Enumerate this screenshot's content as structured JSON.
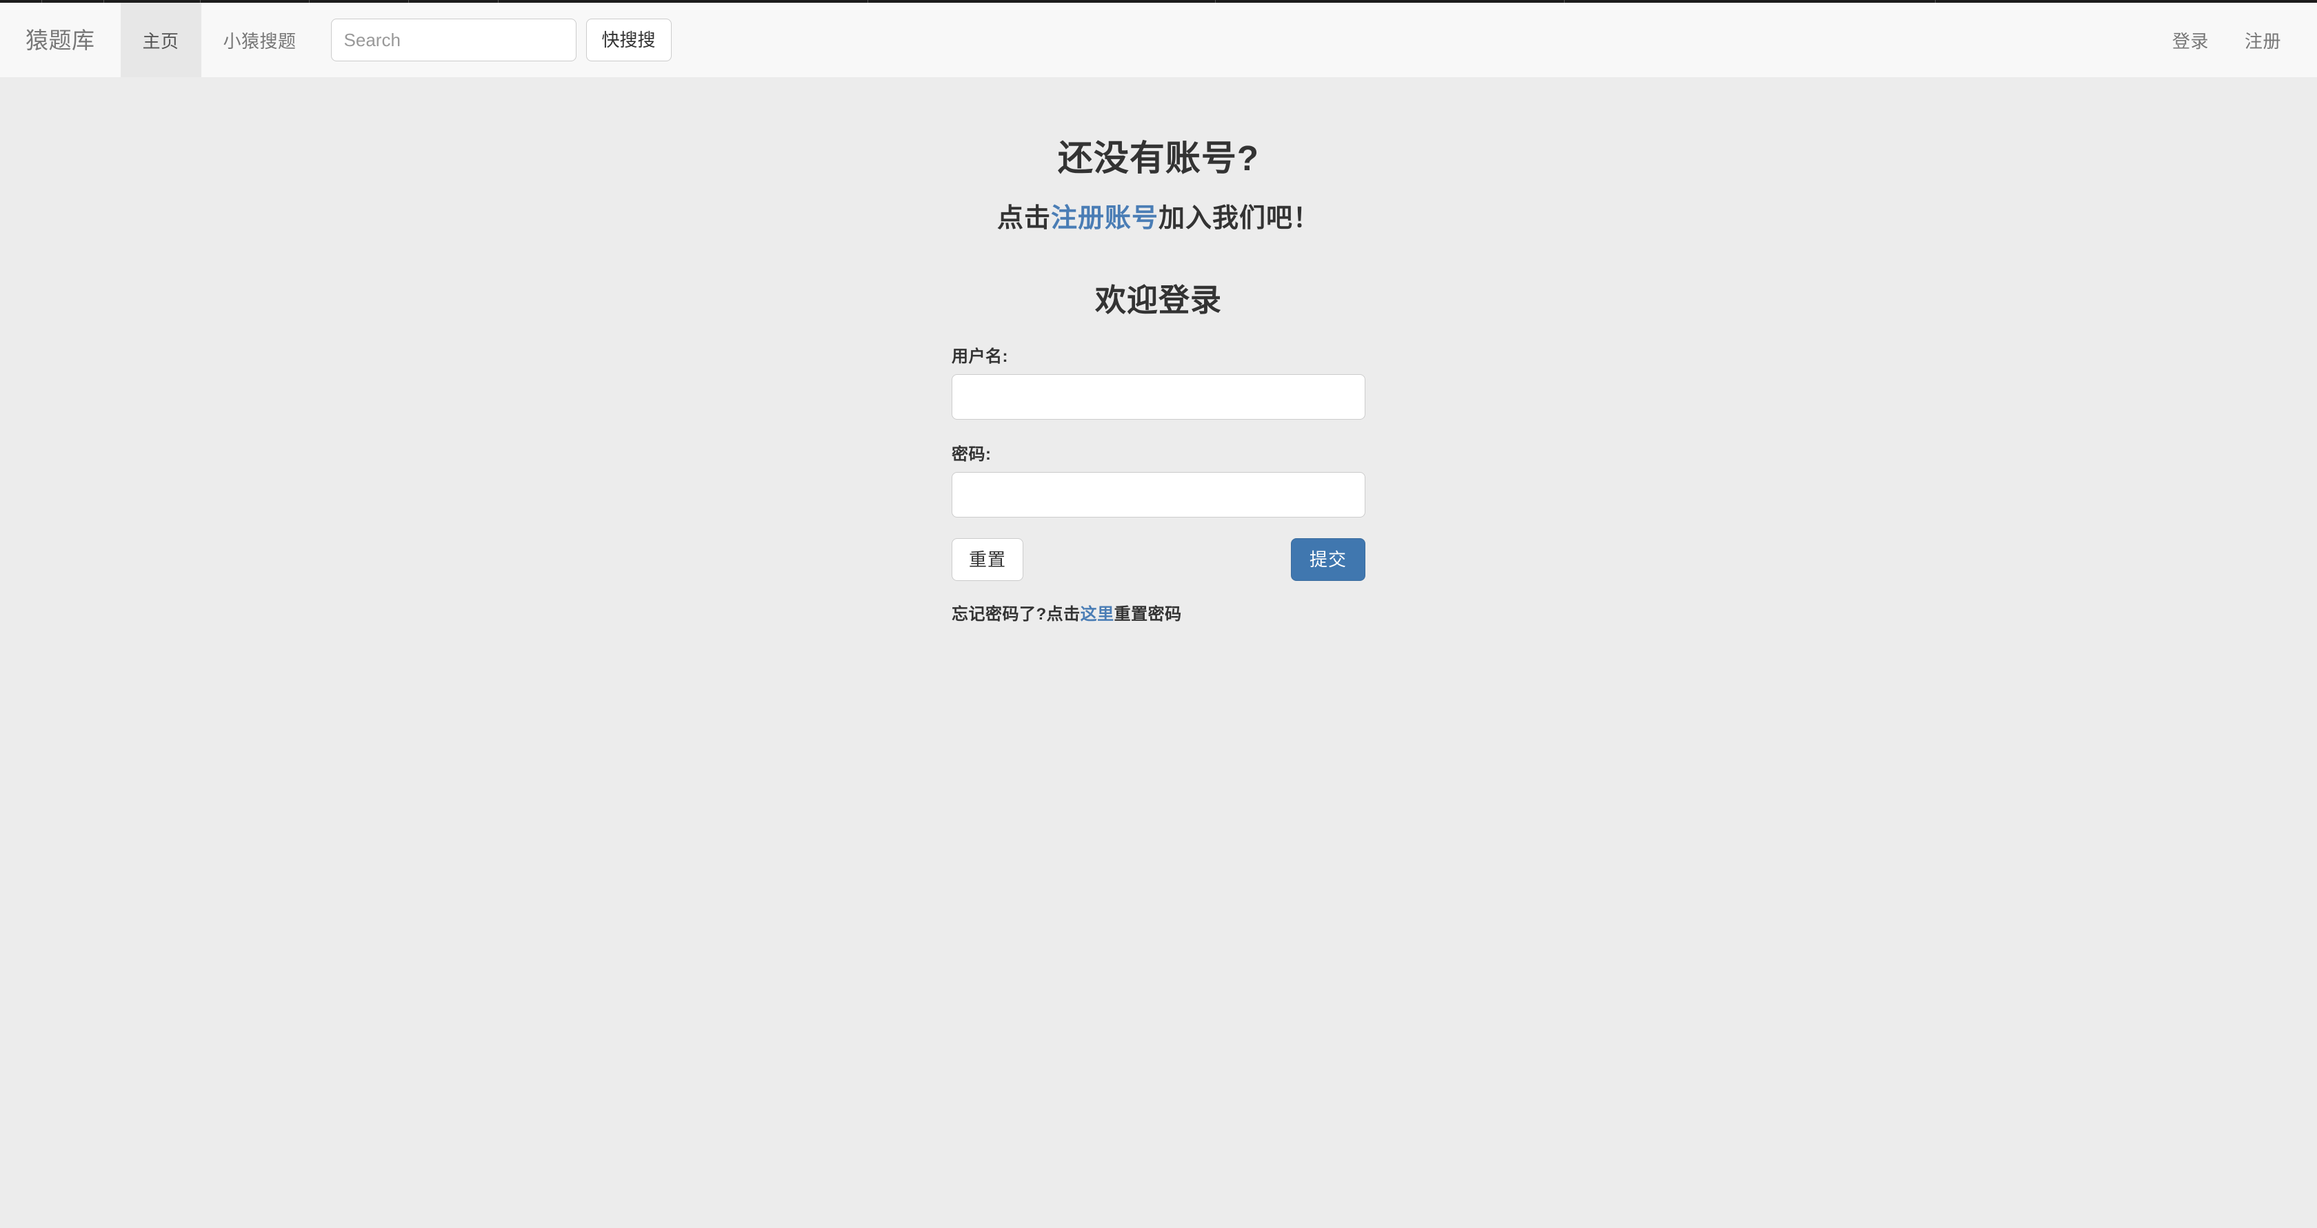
{
  "navbar": {
    "brand": "猿题库",
    "left_items": [
      {
        "label": "主页",
        "active": true
      },
      {
        "label": "小猿搜题",
        "active": false
      }
    ],
    "search": {
      "placeholder": "Search",
      "value": "",
      "button_label": "快搜搜"
    },
    "right_items": [
      {
        "label": "登录"
      },
      {
        "label": "注册"
      }
    ]
  },
  "hero": {
    "title": "还没有账号?",
    "sub_prefix": "点击",
    "sub_link": "注册账号",
    "sub_suffix": "加入我们吧！"
  },
  "form": {
    "title": "欢迎登录",
    "username_label": "用户名:",
    "username_value": "",
    "password_label": "密码:",
    "password_value": "",
    "reset_button": "重置",
    "submit_button": "提交",
    "forgot_prefix": "忘记密码了?点击",
    "forgot_link": "这里",
    "forgot_suffix": "重置密码"
  },
  "colors": {
    "page_background": "#ececec",
    "navbar_background": "#f8f8f8",
    "navbar_active": "#e7e7e7",
    "link": "#4a7db5",
    "primary_button": "#4077af",
    "text": "#333333",
    "muted_text": "#777777"
  }
}
